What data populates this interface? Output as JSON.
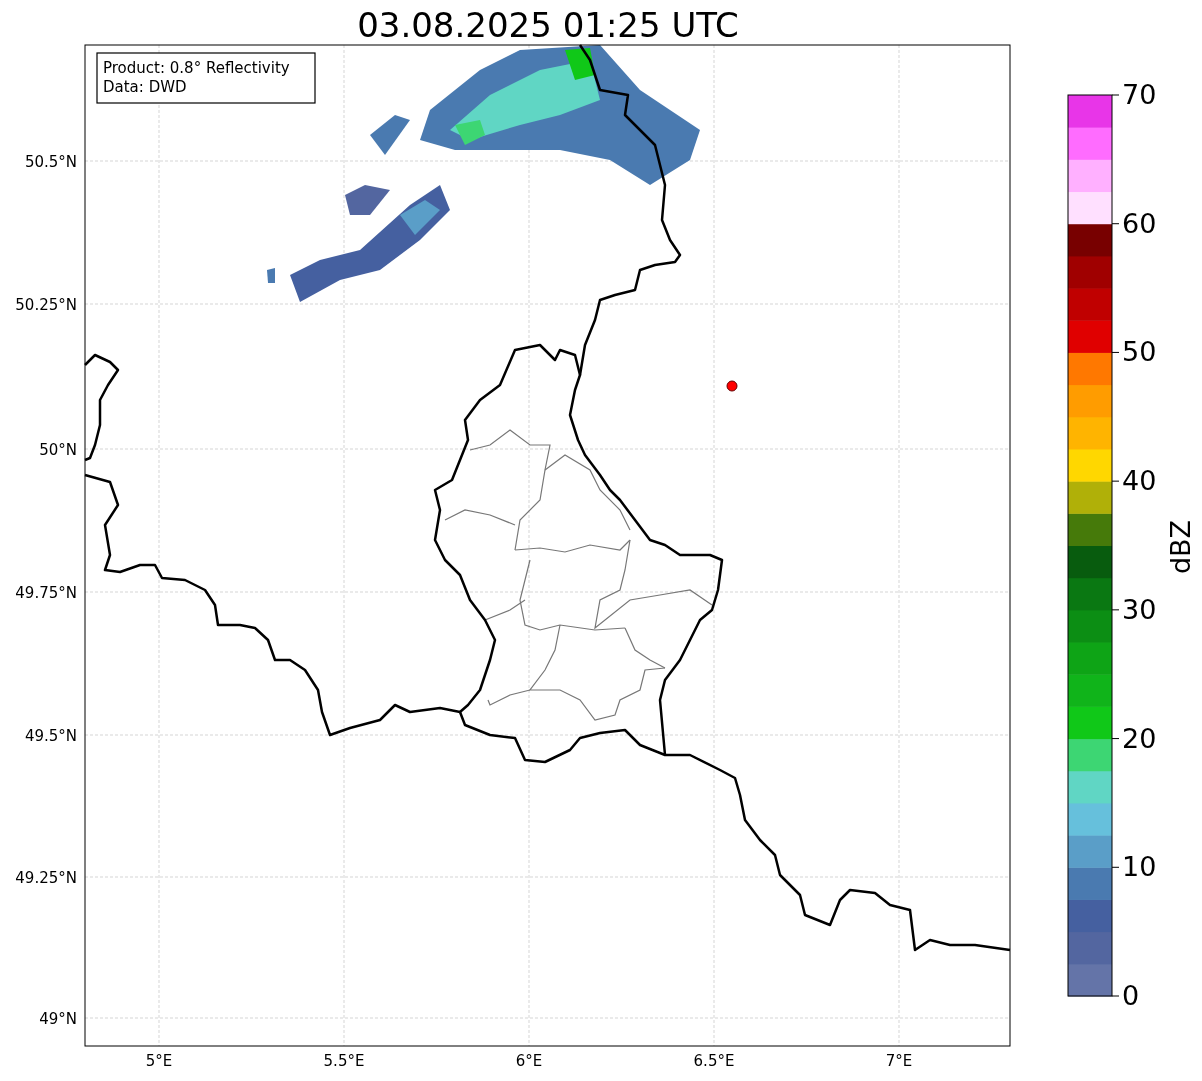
{
  "title": "03.08.2025 01:25 UTC",
  "info_box": [
    "Product: 0.8° Reflectivity",
    "Data: DWD"
  ],
  "lat_ticks": [
    "50.5°N",
    "50.25°N",
    "50°N",
    "49.75°N",
    "49.5°N",
    "49.25°N",
    "49°N"
  ],
  "lon_ticks": [
    "5°E",
    "5.5°E",
    "6°E",
    "6.5°E",
    "7°E"
  ],
  "colorbar": {
    "label": "dBZ",
    "ticks": [
      "70",
      "60",
      "50",
      "40",
      "30",
      "20",
      "10",
      "0"
    ],
    "segments": [
      {
        "color": "#6474a8"
      },
      {
        "color": "#5366a0"
      },
      {
        "color": "#4560a0"
      },
      {
        "color": "#4a7ab0"
      },
      {
        "color": "#5a9ec8"
      },
      {
        "color": "#66c0dc"
      },
      {
        "color": "#60d6c4"
      },
      {
        "color": "#3dd673"
      },
      {
        "color": "#10c818"
      },
      {
        "color": "#10b41a"
      },
      {
        "color": "#0ea416"
      },
      {
        "color": "#0c8e14"
      },
      {
        "color": "#0a7812"
      },
      {
        "color": "#085c0e"
      },
      {
        "color": "#467a0a"
      },
      {
        "color": "#b0b008"
      },
      {
        "color": "#ffd700"
      },
      {
        "color": "#ffb400"
      },
      {
        "color": "#ff9c00"
      },
      {
        "color": "#ff7800"
      },
      {
        "color": "#e00000"
      },
      {
        "color": "#c00000"
      },
      {
        "color": "#a00000"
      },
      {
        "color": "#780000"
      },
      {
        "color": "#ffe0ff"
      },
      {
        "color": "#ffb0ff"
      },
      {
        "color": "#ff6cff"
      },
      {
        "color": "#e835e8"
      }
    ]
  }
}
